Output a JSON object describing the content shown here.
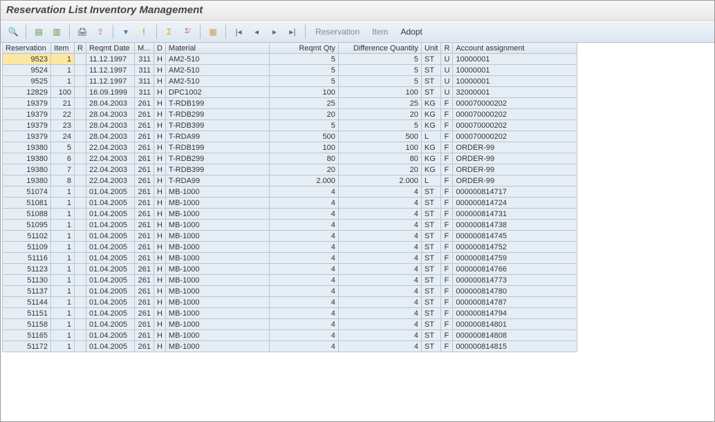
{
  "title": "Reservation List Inventory Management",
  "toolbar": {
    "details_tip": "Details",
    "doc_tip": "Document",
    "doc2_tip": "Document 2",
    "print_tip": "Print",
    "export_tip": "Export",
    "filter_tip": "Filter",
    "info_tip": "Info",
    "sum_tip": "Sum",
    "subtotal_tip": "Subtotal",
    "layout_tip": "Layout",
    "first_tip": "First",
    "prev_tip": "Previous",
    "next_tip": "Next",
    "last_tip": "Last",
    "reservation_label": "Reservation",
    "item_label": "Item",
    "adopt_label": "Adopt"
  },
  "columns": {
    "reservation": "Reservation",
    "item": "Item",
    "r1": "R",
    "reqmt_date": "Reqmt Date",
    "m": "M...",
    "d": "D",
    "material": "Material",
    "reqmt_qty": "Reqmt Qty",
    "diff_qty": "Difference Quantity",
    "unit": "Unit",
    "r2": "R",
    "account": "Account assignment"
  },
  "rows": [
    {
      "res": "9523",
      "item": "1",
      "r1": "",
      "date": "11.12.1997",
      "m": "311",
      "d": "H",
      "mat": "AM2-510",
      "qty": "5",
      "diff": "5",
      "unit": "ST",
      "r2": "U",
      "acc": "10000001",
      "sel": true
    },
    {
      "res": "9524",
      "item": "1",
      "r1": "",
      "date": "11.12.1997",
      "m": "311",
      "d": "H",
      "mat": "AM2-510",
      "qty": "5",
      "diff": "5",
      "unit": "ST",
      "r2": "U",
      "acc": "10000001"
    },
    {
      "res": "9525",
      "item": "1",
      "r1": "",
      "date": "11.12.1997",
      "m": "311",
      "d": "H",
      "mat": "AM2-510",
      "qty": "5",
      "diff": "5",
      "unit": "ST",
      "r2": "U",
      "acc": "10000001"
    },
    {
      "res": "12829",
      "item": "100",
      "r1": "",
      "date": "16.09.1999",
      "m": "311",
      "d": "H",
      "mat": "DPC1002",
      "qty": "100",
      "diff": "100",
      "unit": "ST",
      "r2": "U",
      "acc": "32000001"
    },
    {
      "res": "19379",
      "item": "21",
      "r1": "",
      "date": "28.04.2003",
      "m": "261",
      "d": "H",
      "mat": "T-RDB199",
      "qty": "25",
      "diff": "25",
      "unit": "KG",
      "r2": "F",
      "acc": "000070000202"
    },
    {
      "res": "19379",
      "item": "22",
      "r1": "",
      "date": "28.04.2003",
      "m": "261",
      "d": "H",
      "mat": "T-RDB299",
      "qty": "20",
      "diff": "20",
      "unit": "KG",
      "r2": "F",
      "acc": "000070000202"
    },
    {
      "res": "19379",
      "item": "23",
      "r1": "",
      "date": "28.04.2003",
      "m": "261",
      "d": "H",
      "mat": "T-RDB399",
      "qty": "5",
      "diff": "5",
      "unit": "KG",
      "r2": "F",
      "acc": "000070000202"
    },
    {
      "res": "19379",
      "item": "24",
      "r1": "",
      "date": "28.04.2003",
      "m": "261",
      "d": "H",
      "mat": "T-RDA99",
      "qty": "500",
      "diff": "500",
      "unit": "L",
      "r2": "F",
      "acc": "000070000202"
    },
    {
      "res": "19380",
      "item": "5",
      "r1": "",
      "date": "22.04.2003",
      "m": "261",
      "d": "H",
      "mat": "T-RDB199",
      "qty": "100",
      "diff": "100",
      "unit": "KG",
      "r2": "F",
      "acc": "ORDER-99"
    },
    {
      "res": "19380",
      "item": "6",
      "r1": "",
      "date": "22.04.2003",
      "m": "261",
      "d": "H",
      "mat": "T-RDB299",
      "qty": "80",
      "diff": "80",
      "unit": "KG",
      "r2": "F",
      "acc": "ORDER-99"
    },
    {
      "res": "19380",
      "item": "7",
      "r1": "",
      "date": "22.04.2003",
      "m": "261",
      "d": "H",
      "mat": "T-RDB399",
      "qty": "20",
      "diff": "20",
      "unit": "KG",
      "r2": "F",
      "acc": "ORDER-99"
    },
    {
      "res": "19380",
      "item": "8",
      "r1": "",
      "date": "22.04.2003",
      "m": "261",
      "d": "H",
      "mat": "T-RDA99",
      "qty": "2.000",
      "diff": "2.000",
      "unit": "L",
      "r2": "F",
      "acc": "ORDER-99"
    },
    {
      "res": "51074",
      "item": "1",
      "r1": "",
      "date": "01.04.2005",
      "m": "261",
      "d": "H",
      "mat": "MB-1000",
      "qty": "4",
      "diff": "4",
      "unit": "ST",
      "r2": "F",
      "acc": "000000814717"
    },
    {
      "res": "51081",
      "item": "1",
      "r1": "",
      "date": "01.04.2005",
      "m": "261",
      "d": "H",
      "mat": "MB-1000",
      "qty": "4",
      "diff": "4",
      "unit": "ST",
      "r2": "F",
      "acc": "000000814724"
    },
    {
      "res": "51088",
      "item": "1",
      "r1": "",
      "date": "01.04.2005",
      "m": "261",
      "d": "H",
      "mat": "MB-1000",
      "qty": "4",
      "diff": "4",
      "unit": "ST",
      "r2": "F",
      "acc": "000000814731"
    },
    {
      "res": "51095",
      "item": "1",
      "r1": "",
      "date": "01.04.2005",
      "m": "261",
      "d": "H",
      "mat": "MB-1000",
      "qty": "4",
      "diff": "4",
      "unit": "ST",
      "r2": "F",
      "acc": "000000814738"
    },
    {
      "res": "51102",
      "item": "1",
      "r1": "",
      "date": "01.04.2005",
      "m": "261",
      "d": "H",
      "mat": "MB-1000",
      "qty": "4",
      "diff": "4",
      "unit": "ST",
      "r2": "F",
      "acc": "000000814745"
    },
    {
      "res": "51109",
      "item": "1",
      "r1": "",
      "date": "01.04.2005",
      "m": "261",
      "d": "H",
      "mat": "MB-1000",
      "qty": "4",
      "diff": "4",
      "unit": "ST",
      "r2": "F",
      "acc": "000000814752"
    },
    {
      "res": "51116",
      "item": "1",
      "r1": "",
      "date": "01.04.2005",
      "m": "261",
      "d": "H",
      "mat": "MB-1000",
      "qty": "4",
      "diff": "4",
      "unit": "ST",
      "r2": "F",
      "acc": "000000814759"
    },
    {
      "res": "51123",
      "item": "1",
      "r1": "",
      "date": "01.04.2005",
      "m": "261",
      "d": "H",
      "mat": "MB-1000",
      "qty": "4",
      "diff": "4",
      "unit": "ST",
      "r2": "F",
      "acc": "000000814766"
    },
    {
      "res": "51130",
      "item": "1",
      "r1": "",
      "date": "01.04.2005",
      "m": "261",
      "d": "H",
      "mat": "MB-1000",
      "qty": "4",
      "diff": "4",
      "unit": "ST",
      "r2": "F",
      "acc": "000000814773"
    },
    {
      "res": "51137",
      "item": "1",
      "r1": "",
      "date": "01.04.2005",
      "m": "261",
      "d": "H",
      "mat": "MB-1000",
      "qty": "4",
      "diff": "4",
      "unit": "ST",
      "r2": "F",
      "acc": "000000814780"
    },
    {
      "res": "51144",
      "item": "1",
      "r1": "",
      "date": "01.04.2005",
      "m": "261",
      "d": "H",
      "mat": "MB-1000",
      "qty": "4",
      "diff": "4",
      "unit": "ST",
      "r2": "F",
      "acc": "000000814787"
    },
    {
      "res": "51151",
      "item": "1",
      "r1": "",
      "date": "01.04.2005",
      "m": "261",
      "d": "H",
      "mat": "MB-1000",
      "qty": "4",
      "diff": "4",
      "unit": "ST",
      "r2": "F",
      "acc": "000000814794"
    },
    {
      "res": "51158",
      "item": "1",
      "r1": "",
      "date": "01.04.2005",
      "m": "261",
      "d": "H",
      "mat": "MB-1000",
      "qty": "4",
      "diff": "4",
      "unit": "ST",
      "r2": "F",
      "acc": "000000814801"
    },
    {
      "res": "51165",
      "item": "1",
      "r1": "",
      "date": "01.04.2005",
      "m": "261",
      "d": "H",
      "mat": "MB-1000",
      "qty": "4",
      "diff": "4",
      "unit": "ST",
      "r2": "F",
      "acc": "000000814808"
    },
    {
      "res": "51172",
      "item": "1",
      "r1": "",
      "date": "01.04.2005",
      "m": "261",
      "d": "H",
      "mat": "MB-1000",
      "qty": "4",
      "diff": "4",
      "unit": "ST",
      "r2": "F",
      "acc": "000000814815"
    }
  ]
}
